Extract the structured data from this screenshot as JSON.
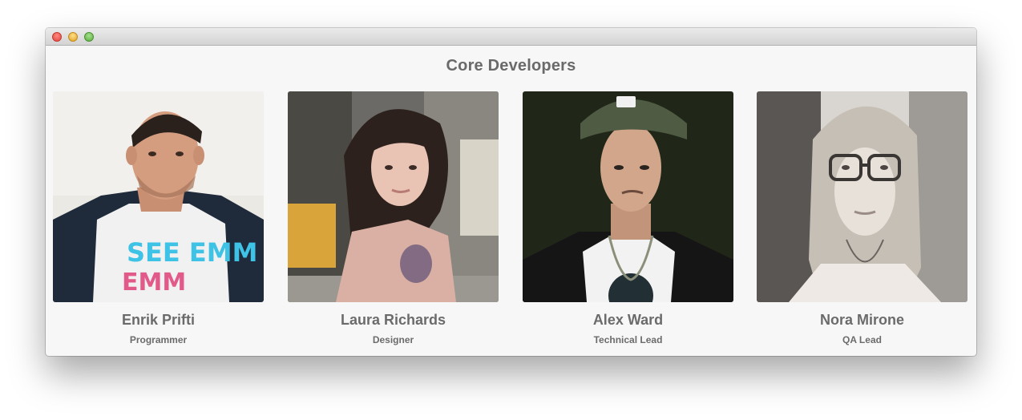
{
  "window": {
    "controls": [
      "close",
      "minimize",
      "zoom"
    ]
  },
  "section": {
    "title": "Core Developers"
  },
  "team": [
    {
      "name": "Enrik Prifti",
      "role": "Programmer",
      "shirt_text": "SEE EMM"
    },
    {
      "name": "Laura Richards",
      "role": "Designer"
    },
    {
      "name": "Alex Ward",
      "role": "Technical Lead"
    },
    {
      "name": "Nora Mirone",
      "role": "QA Lead"
    }
  ]
}
